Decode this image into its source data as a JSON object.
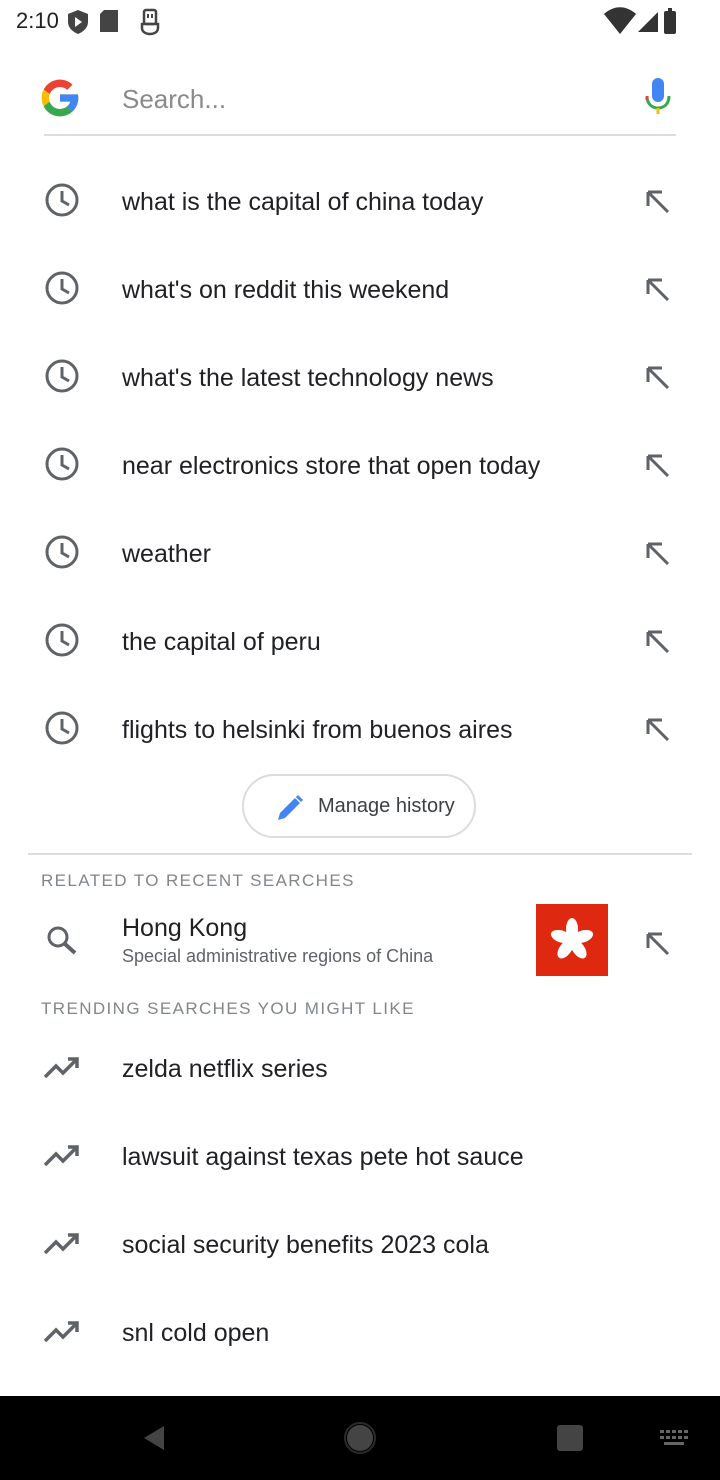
{
  "status_bar": {
    "time": "2:10"
  },
  "search": {
    "value": "",
    "placeholder": "Search..."
  },
  "history": [
    {
      "label": "what is the capital of china today"
    },
    {
      "label": "what's on reddit this weekend"
    },
    {
      "label": "what's the latest technology news"
    },
    {
      "label": "near electronics store that open today"
    },
    {
      "label": "weather"
    },
    {
      "label": "the capital of peru"
    },
    {
      "label": "flights to helsinki from buenos aires"
    }
  ],
  "manage_history": {
    "label": "Manage history"
  },
  "related": {
    "header": "RELATED TO RECENT SEARCHES",
    "item": {
      "title": "Hong Kong",
      "subtitle": "Special administrative regions of China"
    }
  },
  "trending": {
    "header": "TRENDING SEARCHES YOU MIGHT LIKE",
    "items": [
      {
        "label": "zelda netflix series"
      },
      {
        "label": "lawsuit against texas pete hot sauce"
      },
      {
        "label": "social security benefits 2023 cola"
      },
      {
        "label": "snl cold open"
      }
    ]
  },
  "colors": {
    "google_blue": "#4285F4",
    "google_red": "#EA4335",
    "google_yellow": "#FBBC05",
    "google_green": "#34A853",
    "icon_gray": "#5f6368",
    "hk_flag_red": "#DE2910"
  },
  "icons": {
    "history": "clock-icon",
    "suggestion_arrow": "arrow-up-left-icon",
    "trending": "trending-up-icon",
    "search": "search-icon",
    "mic": "mic-icon",
    "edit": "pencil-icon"
  }
}
